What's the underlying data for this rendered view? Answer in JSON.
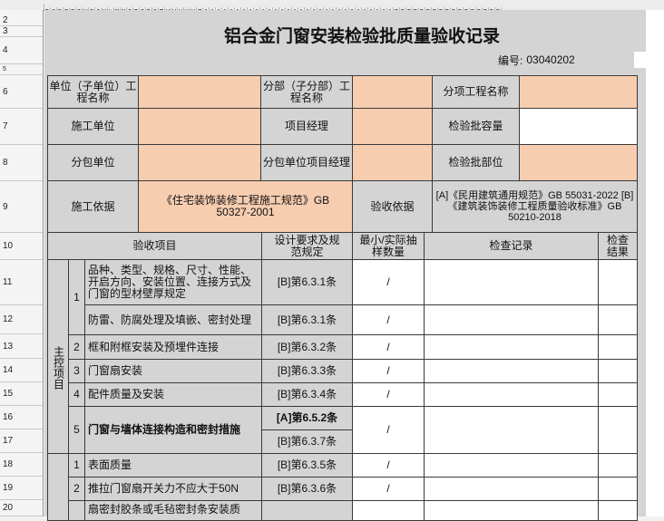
{
  "col_header_letters": "BCDEFGHIJKLMNOPQRSTUVWXYZAAAAAAAAAAAAAAAAAAAAAAAAAAAAAABBBBBBBBBBBBBBBBB",
  "row_labels": {
    "r2": "2",
    "r3": "3",
    "r4": "4",
    "r5": "5",
    "r6": "6",
    "r7": "7",
    "r8": "8",
    "r9": "9",
    "r10": "10",
    "r11": "11",
    "r12": "12",
    "r13": "13",
    "r14": "14",
    "r15": "15",
    "r16": "16",
    "r17": "17",
    "r18": "18",
    "r19": "19",
    "r20": "20"
  },
  "title": "铝合金门窗安装检验批质量验收记录",
  "code": {
    "label": "编号:",
    "value": "03040202"
  },
  "info": {
    "unit_name": "单位（子单位）工程名称",
    "division_name": "分部（子分部）工程名称",
    "subitem_name": "分项工程名称",
    "construction_unit": "施工单位",
    "project_manager": "项目经理",
    "batch_capacity": "检验批容量",
    "subcontract_unit": "分包单位",
    "subcontract_manager": "分包单位项目经理",
    "batch_location": "检验批部位",
    "basis_label": "施工依据",
    "basis_value": "《住宅装饰装修工程施工规范》GB 50327-2001",
    "acceptance_label": "验收依据",
    "acceptance_value": "[A]《民用建筑通用规范》GB 55031-2022 [B]《建筑装饰装修工程质量验收标准》GB 50210-2018"
  },
  "header": {
    "items": "验收项目",
    "design": "设计要求及规范规定",
    "sample": "最小/实际抽样数量",
    "record": "检查记录",
    "result": "检查结果"
  },
  "main_group": "主控项目",
  "rows": {
    "i1": {
      "num": "1",
      "text_a": "品种、类型、规格、尺寸、性能、开启方向、安装位置、连接方式及门窗的型材壁厚规定",
      "spec_a": "[B]第6.3.1条",
      "text_b": "防雷、防腐处理及填嵌、密封处理",
      "spec_b": "[B]第6.3.1条"
    },
    "i2": {
      "num": "2",
      "text": "框和附框安装及预埋件连接",
      "spec": "[B]第6.3.2条"
    },
    "i3": {
      "num": "3",
      "text": "门窗扇安装",
      "spec": "[B]第6.3.3条"
    },
    "i4": {
      "num": "4",
      "text": "配件质量及安装",
      "spec": "[B]第6.3.4条"
    },
    "i5": {
      "num": "5",
      "text": "门窗与墙体连接构造和密封措施",
      "spec_a": "[A]第6.5.2条",
      "spec_b": "[B]第6.3.7条"
    },
    "g1": {
      "num": "1",
      "text": "表面质量",
      "spec": "[B]第6.3.5条"
    },
    "g2": {
      "num": "2",
      "text": "推拉门窗扇开关力不应大于50N",
      "spec": "[B]第6.3.6条"
    },
    "g3": {
      "text": "扇密封胶条或毛毡密封条安装质"
    }
  },
  "slash": "/"
}
